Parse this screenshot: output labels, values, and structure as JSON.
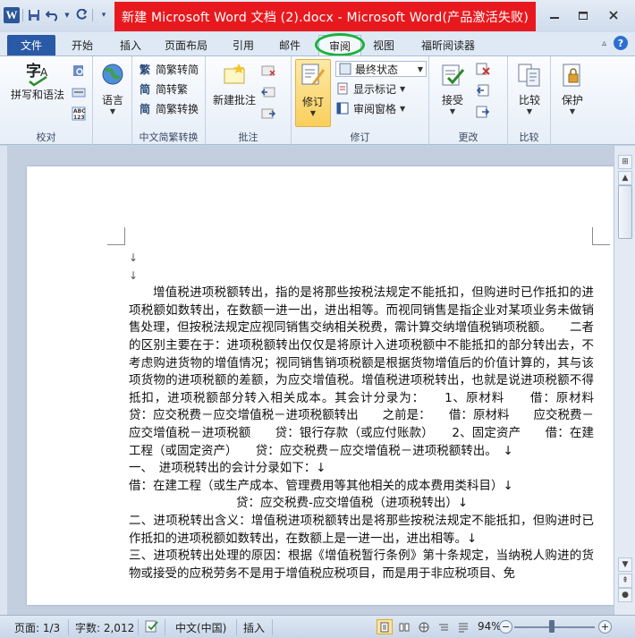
{
  "window": {
    "title": "新建 Microsoft Word 文档 (2).docx - Microsoft Word(产品激活失败)",
    "word_logo": "W",
    "title_bar_color": "#e8191e"
  },
  "tabs": [
    {
      "label": "文件"
    },
    {
      "label": "开始"
    },
    {
      "label": "插入"
    },
    {
      "label": "页面布局"
    },
    {
      "label": "引用"
    },
    {
      "label": "邮件"
    },
    {
      "label": "审阅"
    },
    {
      "label": "视图"
    },
    {
      "label": "福昕阅读器"
    }
  ],
  "ribbon": {
    "proofing": {
      "spell_label": "拼写和语法",
      "language_label": "语言",
      "group_label": "校对"
    },
    "chinese_conv": {
      "to_trad": "简繁转简",
      "to_simp": "简转繁",
      "convert": "简繁转换",
      "group_label": "中文简繁转换"
    },
    "comments": {
      "new_comment": "新建批注",
      "group_label": "批注"
    },
    "tracking": {
      "track_changes": "修订",
      "final_state": "最终状态",
      "show_markup": "显示标记",
      "review_pane": "审阅窗格",
      "group_label": "修订"
    },
    "changes": {
      "accept": "接受",
      "group_label": "更改"
    },
    "compare": {
      "compare": "比较",
      "group_label": "比较"
    },
    "protect": {
      "protect": "保护"
    }
  },
  "document": {
    "lines": [
      "↓",
      "↓",
      "增值税进项税额转出，指的是将那些按税法规定不能抵扣，但购进时已作抵扣的进项税额如数转出，在数额一进一出，进出相等。而视同销售是指企业对某项业务未做销售处理，但按税法规定应视同销售交纳相关税费，需计算交纳增值税销项税额。　　二者的区别主要在于：进项税额转出仅仅是将原计入进项税额中不能抵扣的部分转出去，不考虑购进货物的增值情况；视同销售销项税额是根据货物增值后的价值计算的，其与该项货物的进项税额的差额，为应交增值税。增值税进项税转出，也就是说进项税额不得抵扣，进项税额部分转入相关成本。其会计分录为：　　1、原材料　　借：原材料　　贷：应交税费－应交增值税－进项税额转出　　之前是：　　借：原材料　　应交税费－应交增值税－进项税额　　贷：银行存款（或应付账款）　　2、固定资产　　借：在建工程（或固定资产）　　贷：应交税费－应交增值税－进项税额转出。　↓",
      "一、　进项税转出的会计分录如下：↓",
      "借：在建工程（或生产成本、管理费用等其他相关的成本费用类科目）↓",
      "贷：应交税费-应交增值税（进项税转出）↓",
      "二、进项税转出含义：增值税进项税额转出是将那些按税法规定不能抵扣，但购进时已作抵扣的进项税额如数转出，在数额上是一进一出，进出相等。↓",
      "三、进项税转出处理的原因：根据《增值税暂行条例》第十条规定，当纳税人购进的货物或接受的应税劳务不是用于增值税应税项目，而是用于非应税项目、免"
    ]
  },
  "statusbar": {
    "page": "页面: 1/3",
    "words": "字数: 2,012",
    "language": "中文(中国)",
    "insert_mode": "插入",
    "zoom": "94%",
    "zoom_fraction": 0.47
  },
  "colors": {
    "accent_green_circle": "#17b33a",
    "file_tab": "#2a5aa6",
    "active_button": "#f9cf5c"
  }
}
